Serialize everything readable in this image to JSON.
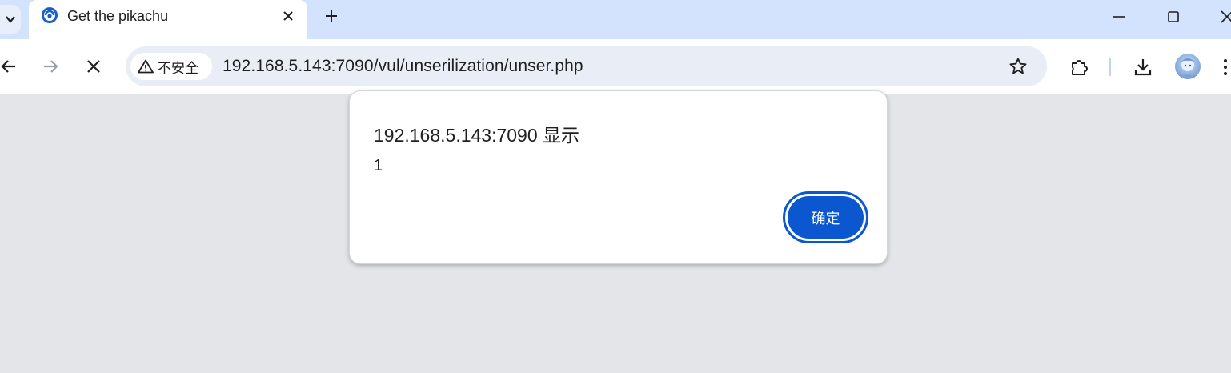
{
  "tab": {
    "title": "Get the pikachu",
    "favicon": "pikachu-site-favicon"
  },
  "toolbar": {
    "security_label": "不安全",
    "url": "192.168.5.143:7090/vul/unserilization/unser.php"
  },
  "dialog": {
    "title": "192.168.5.143:7090 显示",
    "message": "1",
    "ok_label": "确定"
  },
  "colors": {
    "tabstrip": "#d3e3fd",
    "omnibox": "#e9eef6",
    "page_bg": "#e4e5e9",
    "accent": "#0b57d0"
  },
  "icons": {
    "tab_menu": "chevron-down-icon",
    "tab_close": "close-icon",
    "new_tab": "plus-icon",
    "minimize": "minimize-icon",
    "maximize": "maximize-icon",
    "window_close": "close-icon",
    "back": "arrow-left-icon",
    "forward": "arrow-right-icon",
    "stop": "close-icon",
    "security": "warning-icon",
    "bookmark": "star-icon",
    "extensions": "puzzle-icon",
    "downloads": "download-icon",
    "profile": "avatar",
    "menu": "more-vert-icon"
  }
}
